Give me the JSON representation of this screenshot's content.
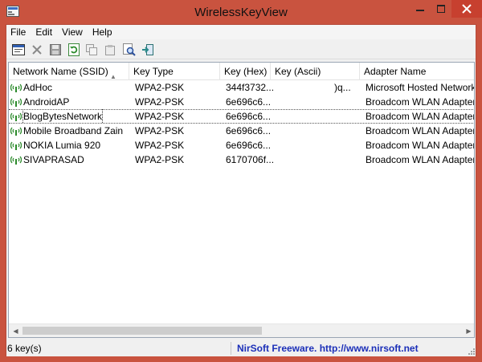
{
  "window": {
    "title": "WirelessKeyView"
  },
  "menu": [
    "File",
    "Edit",
    "View",
    "Help"
  ],
  "toolbar": {
    "buttons": [
      "html-report",
      "delete",
      "save",
      "refresh",
      "copy",
      "copy-key",
      "find",
      "exit"
    ]
  },
  "table": {
    "columns": [
      "Network Name (SSID)",
      "Key Type",
      "Key (Hex)",
      "Key (Ascii)",
      "Adapter Name"
    ],
    "rows": [
      {
        "name": "AdHoc",
        "type": "WPA2-PSK",
        "hex": "344f3732...",
        "ascii": ")q...",
        "adapter": "Microsoft Hosted Network V"
      },
      {
        "name": "AndroidAP",
        "type": "WPA2-PSK",
        "hex": "6e696c6...",
        "ascii": "",
        "adapter": "Broadcom WLAN Adapter"
      },
      {
        "name": "BlogBytesNetwork",
        "type": "WPA2-PSK",
        "hex": "6e696c6...",
        "ascii": "",
        "adapter": "Broadcom WLAN Adapter"
      },
      {
        "name": "Mobile Broadband Zain",
        "type": "WPA2-PSK",
        "hex": "6e696c6...",
        "ascii": "",
        "adapter": "Broadcom WLAN Adapter"
      },
      {
        "name": "NOKIA Lumia 920",
        "type": "WPA2-PSK",
        "hex": "6e696c6...",
        "ascii": "",
        "adapter": "Broadcom WLAN Adapter"
      },
      {
        "name": "SIVAPRASAD",
        "type": "WPA2-PSK",
        "hex": "6170706f...",
        "ascii": "",
        "adapter": "Broadcom WLAN Adapter"
      }
    ]
  },
  "status": {
    "count": "6 key(s)",
    "credit": "NirSoft Freeware.  http://www.nirsoft.net"
  },
  "colors": {
    "frame": "#c9533f",
    "close_button": "#c7402f",
    "link_text": "#1b2fb8"
  }
}
